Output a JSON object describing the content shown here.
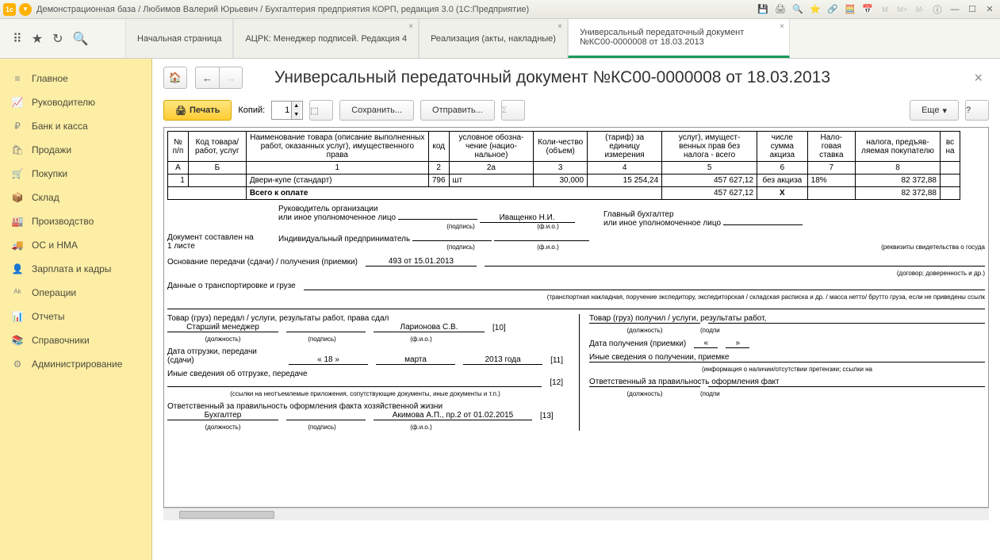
{
  "titlebar": {
    "title": "Демонстрационная база / Любимов Валерий Юрьевич / Бухгалтерия предприятия КОРП, редакция 3.0  (1С:Предприятие)"
  },
  "tabs": [
    {
      "label": "Начальная страница"
    },
    {
      "label": "АЦРК: Менеджер подписей. Редакция 4"
    },
    {
      "label": "Реализация (акты, накладные)"
    },
    {
      "label": "Универсальный передаточный документ №КС00-0000008 от 18.03.2013",
      "active": true
    }
  ],
  "sidebar": {
    "items": [
      {
        "icon": "≡",
        "label": "Главное"
      },
      {
        "icon": "📈",
        "label": "Руководителю"
      },
      {
        "icon": "₽",
        "label": "Банк и касса"
      },
      {
        "icon": "🛍",
        "label": "Продажи"
      },
      {
        "icon": "🛒",
        "label": "Покупки"
      },
      {
        "icon": "📦",
        "label": "Склад"
      },
      {
        "icon": "🏭",
        "label": "Производство"
      },
      {
        "icon": "🚚",
        "label": "ОС и НМА"
      },
      {
        "icon": "👤",
        "label": "Зарплата и кадры"
      },
      {
        "icon": "ᴬᵏ",
        "label": "Операции"
      },
      {
        "icon": "📊",
        "label": "Отчеты"
      },
      {
        "icon": "📚",
        "label": "Справочники"
      },
      {
        "icon": "⚙",
        "label": "Администрирование"
      }
    ]
  },
  "doc": {
    "title": "Универсальный передаточный документ №КС00-0000008 от 18.03.2013",
    "toolbar": {
      "print": "Печать",
      "copies_label": "Копий:",
      "copies": "1",
      "save": "Сохранить...",
      "send": "Отправить...",
      "more": "Еще",
      "help": "?"
    },
    "table": {
      "headers": {
        "npp": "№ п/п",
        "code": "Код товара/ работ, услуг",
        "name": "Наименование товара (описание выполненных работ, оказанных услуг), имущественного права",
        "unit_code": "код",
        "unit_name": "условное обозна-чение (нацио-нальное)",
        "qty": "Коли-чество (объем)",
        "price": "(тариф) за единицу измерения",
        "sum_no_tax": "услуг), имущест-венных прав без налога - всего",
        "excise": "числе сумма акциза",
        "tax_rate": "Нало-говая ставка",
        "total": "налога, предъяв-ляемая покупателю",
        "vs": "вс на"
      },
      "sub": {
        "a": "А",
        "b": "Б",
        "c1": "1",
        "c2": "2",
        "c2a": "2а",
        "c3": "3",
        "c4": "4",
        "c5": "5",
        "c6": "6",
        "c7": "7",
        "c8": "8"
      },
      "row": {
        "n": "1",
        "code": "",
        "name": "Двери-купе (стандарт)",
        "ucode": "796",
        "uname": "шт",
        "qty": "30,000",
        "price": "15 254,24",
        "sum": "457 627,12",
        "excise": "без акциза",
        "rate": "18%",
        "total": "82 372,88"
      },
      "total_row": {
        "label": "Всего к оплате",
        "sum": "457 627,12",
        "x": "Х",
        "total": "82 372,88"
      }
    },
    "signatures": {
      "doc_on": "Документ составлен на",
      "sheets": "1 листе",
      "head_org": "Руководитель организации",
      "or_auth": "или иное уполномоченное лицо",
      "head_name": "Иващенко Н.И.",
      "podpis": "(подпись)",
      "fio": "(ф.и.о.)",
      "ip": "Индивидуальный предприниматель",
      "chief_acc": "Главный бухгалтер",
      "rekv": "(реквизиты свидетельства о госуда",
      "basis": "Основание передачи (сдачи) / получения (приемки)",
      "basis_val": "493 от 15.01.2013",
      "basis_note": "(договор; доверенность и др.)",
      "transport": "Данные о транспортировке и грузе",
      "transport_note": "(транспортная накладная, поручение экспедитору, экспедиторская / складская расписка и др. / масса нетто/ брутто груза, если не приведены ссылк"
    },
    "left_col": {
      "l1": "Товар (груз) передал / услуги, результаты работ, права сдал",
      "position": "Старший менеджер",
      "name": "Ларионова С.В.",
      "n10": "[10]",
      "pos_lbl": "(должность)",
      "date_lbl": "Дата отгрузки, передачи (сдачи)",
      "date_d": "« 18 »",
      "date_m": "марта",
      "date_y": "2013  года",
      "n11": "[11]",
      "other": "Иные сведения об отгрузке, передаче",
      "n12": "[12]",
      "other_note": "(ссылки на неотъемлемые приложения, сопутствующие документы, иные документы и т.п.)",
      "resp": "Ответственный за правильность оформления факта хозяйственной жизни",
      "resp_pos": "Бухгалтер",
      "resp_name": "Акимова А.П., пр.2 от 01.02.2015",
      "n13": "[13]"
    },
    "right_col": {
      "l1": "Товар (груз) получил / услуги, результаты работ,",
      "pos_lbl": "(должность)",
      "podp": "(подпи",
      "date_lbl": "Дата получения (приемки)",
      "date_open": "«",
      "date_close": "»",
      "other": "Иные сведения о получении, приемке",
      "other_note": "(информация о наличии/отсутствии претензии; ссылки на",
      "resp": "Ответственный за правильность оформления факт"
    }
  }
}
